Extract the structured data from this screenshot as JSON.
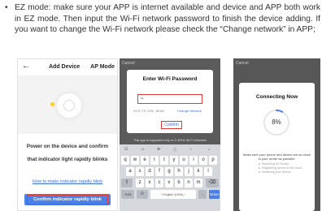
{
  "instruction": {
    "bullet": "•",
    "text": "EZ mode: make sure your APP is internet available and device and APP both work in EZ mode. Then input the Wi-Fi network password to finish the device adding. If you want to change the Wi-Fi network please check the “Change network” in APP;"
  },
  "screen1": {
    "back_icon": "←",
    "title": "Add Device",
    "mode": "AP Mode",
    "line1": "Power on the device and confirm",
    "line2": "that indicator light rapidly blinks",
    "link": "How to make indicator rapidly blink",
    "confirm_button": "Confirm indicator rapidly blink",
    "colors": {
      "accent": "#4a80e8",
      "highlight": "#e53935",
      "led": "#ffcc22"
    }
  },
  "screen2": {
    "cancel": "Cancel",
    "title": "Enter Wi-Fi Password",
    "password_value": "••",
    "ssid": "Wi-Fi TP-LINK_5EA8",
    "change_network": "Change Network",
    "confirm": "Confirm",
    "note": "This app is supported only on 2.4GHz Wi-Fi channels",
    "toolbar": [
      "☷",
      "☺",
      "⊕",
      "ⓘ",
      "○",
      "⌄"
    ],
    "rows": [
      [
        "q",
        "w",
        "e",
        "r",
        "t",
        "y",
        "u",
        "i",
        "o",
        "p"
      ],
      [
        "a",
        "s",
        "d",
        "f",
        "g",
        "h",
        "j",
        "k",
        "l"
      ],
      [
        "⇧",
        "z",
        "x",
        "c",
        "v",
        "b",
        "n",
        "m",
        "⌫"
      ]
    ],
    "bottom": {
      "num": "?123",
      "globe": "☺",
      "space": "‹ English (USA) ›",
      "period": ".",
      "done": "Done"
    }
  },
  "screen3": {
    "cancel": "Cancel",
    "title": "Connecting Now",
    "progress_percent": 8,
    "progress_label": "8%",
    "hint": "Make sure your phone and device are as close to your router as possible.",
    "steps": [
      "Searching for Device",
      "Registering device to the cloud",
      "Initializing your Device"
    ]
  }
}
